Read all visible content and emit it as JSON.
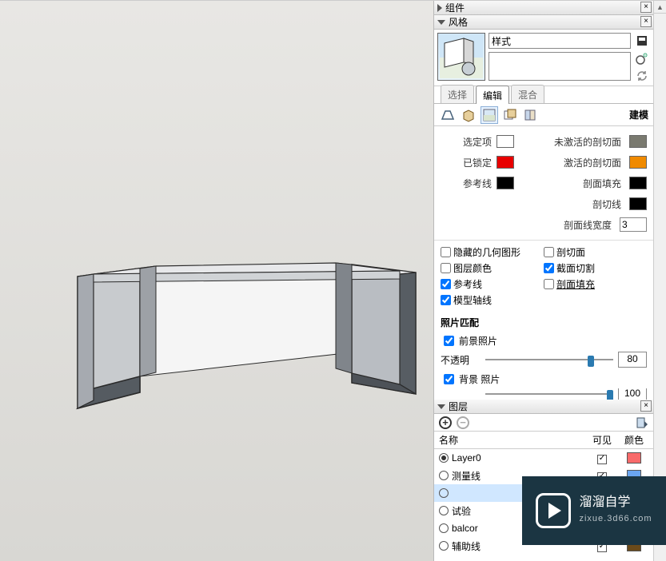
{
  "panels": {
    "components": "组件",
    "styles": "风格",
    "layers": "图层"
  },
  "style": {
    "name": "样式",
    "description": ""
  },
  "tabs": {
    "select": "选择",
    "edit": "编辑",
    "mix": "混合"
  },
  "modeling_label": "建模",
  "edge": {
    "selected": "选定项",
    "selected_color": "#0033ee",
    "inactive_section": "未激活的剖切面",
    "inactive_section_color": "#7a7a70",
    "locked": "已锁定",
    "locked_color": "#e80000",
    "active_section": "激活的剖切面",
    "active_section_color": "#f08a00",
    "guide": "参考线",
    "guide_color": "#000000",
    "section_fill": "剖面填充",
    "section_fill_color": "#000000",
    "section_line": "剖切线",
    "section_line_color": "#000000",
    "section_width_label": "剖面线宽度",
    "section_width": "3"
  },
  "checks": {
    "hidden_geom": "隐藏的几何图形",
    "layer_color": "图层颜色",
    "guides": "参考线",
    "model_axes": "模型轴线",
    "section_planes": "剖切面",
    "section_cut": "截面切割",
    "section_fill": "剖面填充"
  },
  "photo": {
    "title": "照片匹配",
    "foreground": "前景照片",
    "opacity_label": "不透明",
    "opacity": "80",
    "background": "背景 照片",
    "opacity2": "100"
  },
  "layer_headers": {
    "name": "名称",
    "visible": "可见",
    "color": "颜色"
  },
  "layers": [
    {
      "name": "Layer0",
      "active": true,
      "visible": true,
      "color": "#f86a6a"
    },
    {
      "name": "测量线",
      "active": false,
      "visible": true,
      "color": "#6aa5f0"
    },
    {
      "name": "",
      "active": false,
      "visible": true,
      "color": "#5fd6d6"
    },
    {
      "name": "试验",
      "active": false,
      "visible": true,
      "color": "#8a3a1a"
    },
    {
      "name": "balcor",
      "active": false,
      "visible": true,
      "color": "#a28fd0"
    },
    {
      "name": "辅助线",
      "active": false,
      "visible": true,
      "color": "#6a4a1a"
    }
  ],
  "watermark": {
    "line1": "溜溜自学",
    "line2": "zixue.3d66.com"
  }
}
